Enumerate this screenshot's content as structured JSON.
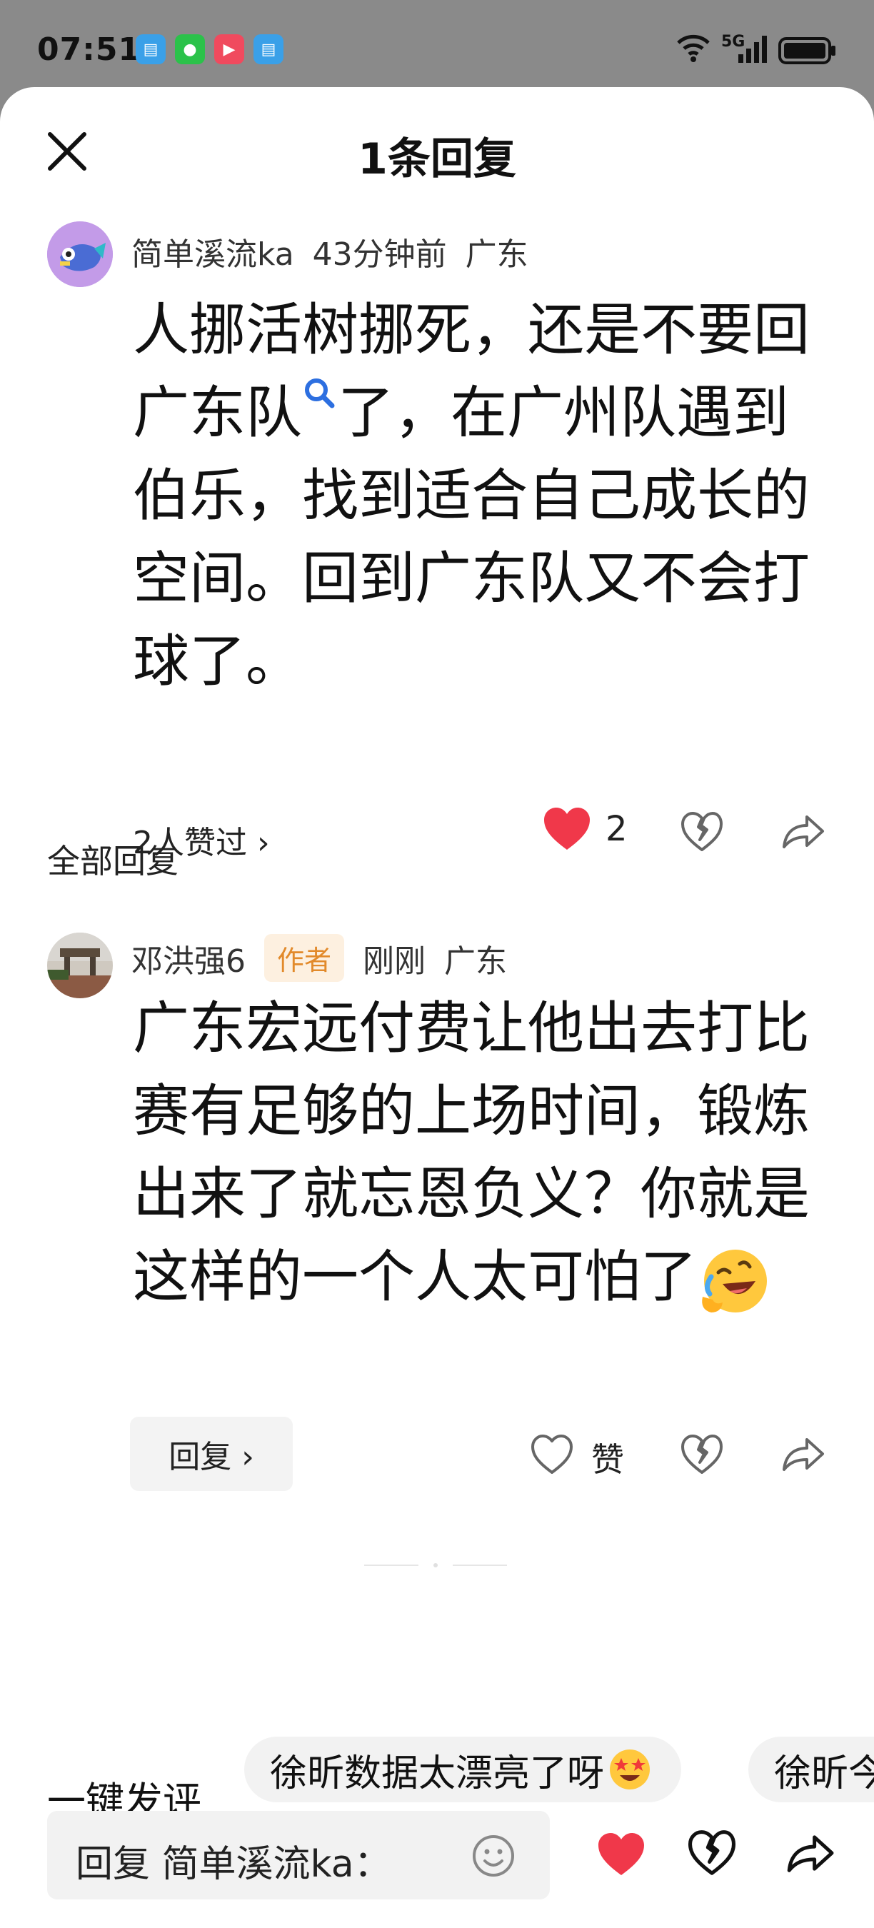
{
  "status_bar": {
    "time": "07:51",
    "network": "5G"
  },
  "sheet": {
    "title": "1条回复"
  },
  "main_comment": {
    "username": "简单溪流ka",
    "time": "43分钟前",
    "location": "广东",
    "text_before_link": "人挪活树挪死，还是不要回广东队",
    "text_after_link": "了，在广州队遇到伯乐，找到适合自己成长的空间。回到广东队又不会打球了。",
    "likes_link": "2人赞过 ›",
    "like_count": "2"
  },
  "section_label": "全部回复",
  "reply": {
    "username": "邓洪强6",
    "badge": "作者",
    "time": "刚刚",
    "location": "广东",
    "text": "广东宏远付费让他出去打比赛有足够的上场时间，锻炼出来了就忘恩负义？你就是这样的一个人太可怕了",
    "reply_button": "回复 ›",
    "like_label": "赞"
  },
  "bottom": {
    "quick_label": "一键发评",
    "chips": [
      "徐昕数据太漂亮了呀",
      "徐昕今"
    ],
    "input_placeholder": "回复 简单溪流ka："
  },
  "colors": {
    "like_red": "#f0384a",
    "badge_orange": "#e28a2b",
    "link_blue": "#2d6fe0"
  }
}
